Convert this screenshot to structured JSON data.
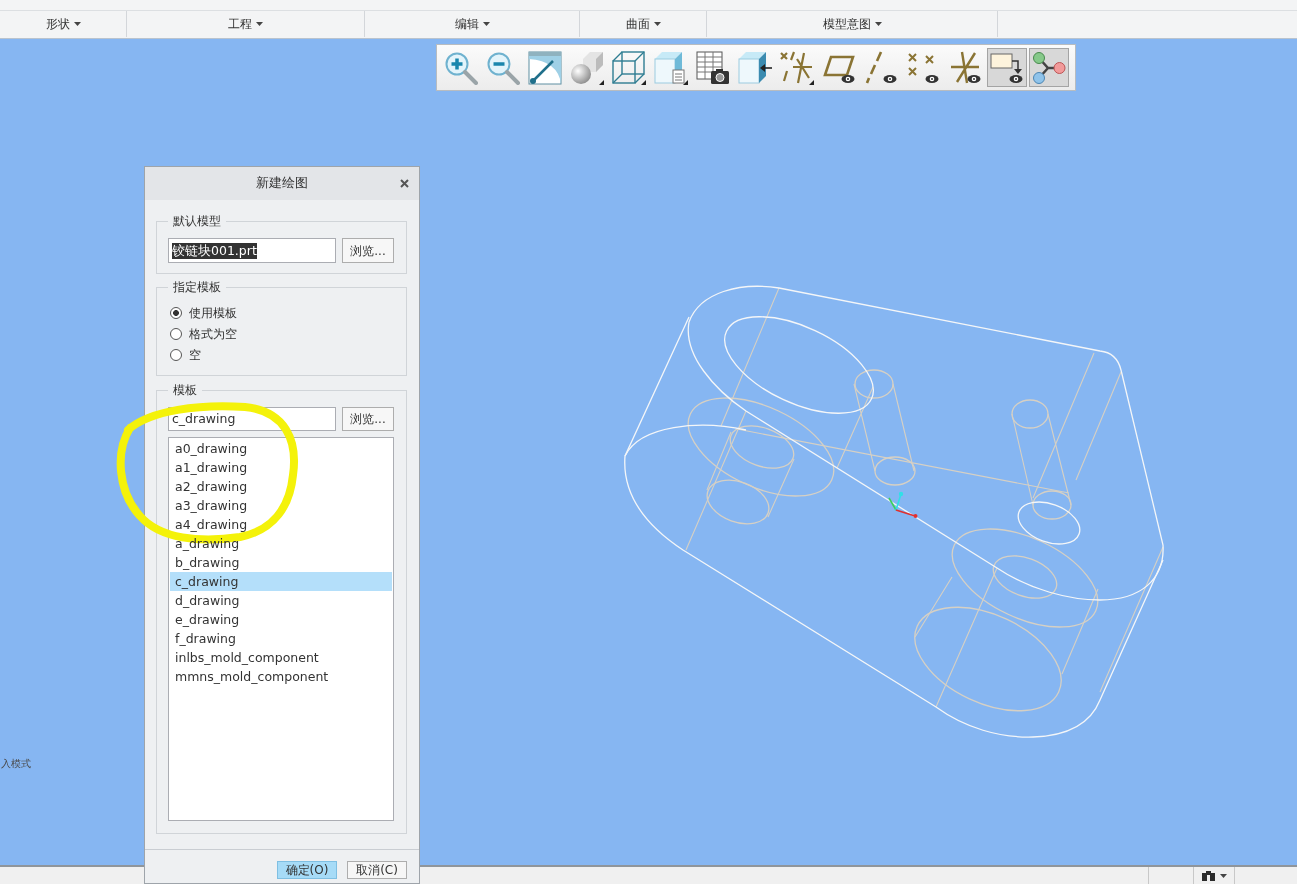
{
  "ribbon": {
    "groups": [
      {
        "label": "形状"
      },
      {
        "label": "工程"
      },
      {
        "label": "编辑"
      },
      {
        "label": "曲面"
      },
      {
        "label": "模型意图"
      }
    ]
  },
  "view_toolbar": {
    "buttons": [
      {
        "on": false
      },
      {
        "on": false
      },
      {
        "on": false
      },
      {
        "on": false
      },
      {
        "on": false
      },
      {
        "on": false
      },
      {
        "on": false
      },
      {
        "on": false
      },
      {
        "on": false
      },
      {
        "on": false
      },
      {
        "on": false
      },
      {
        "on": false
      },
      {
        "on": false
      },
      {
        "on": true
      },
      {
        "on": true
      }
    ]
  },
  "viewport": {
    "side_text": "入模式"
  },
  "dialog": {
    "title": "新建绘图",
    "default_model": {
      "legend": "默认模型",
      "value": "铰链块001.prt",
      "text_selected": true,
      "browse": "浏览..."
    },
    "template_mode": {
      "legend": "指定模板",
      "options": [
        {
          "label": "使用模板",
          "selected": true
        },
        {
          "label": "格式为空",
          "selected": false
        },
        {
          "label": "空",
          "selected": false
        }
      ]
    },
    "template": {
      "legend": "模板",
      "value": "c_drawing",
      "browse": "浏览...",
      "items": [
        {
          "label": "a0_drawing",
          "selected": false
        },
        {
          "label": "a1_drawing",
          "selected": false
        },
        {
          "label": "a2_drawing",
          "selected": false
        },
        {
          "label": "a3_drawing",
          "selected": false
        },
        {
          "label": "a4_drawing",
          "selected": false
        },
        {
          "label": "a_drawing",
          "selected": false
        },
        {
          "label": "b_drawing",
          "selected": false
        },
        {
          "label": "c_drawing",
          "selected": true
        },
        {
          "label": "d_drawing",
          "selected": false
        },
        {
          "label": "e_drawing",
          "selected": false
        },
        {
          "label": "f_drawing",
          "selected": false
        },
        {
          "label": "inlbs_mold_component",
          "selected": false
        },
        {
          "label": "mmns_mold_component",
          "selected": false
        }
      ]
    },
    "buttons": [
      {
        "label": "确定(O)",
        "kind": "default"
      },
      {
        "label": "取消(C)",
        "kind": "normal"
      }
    ]
  }
}
